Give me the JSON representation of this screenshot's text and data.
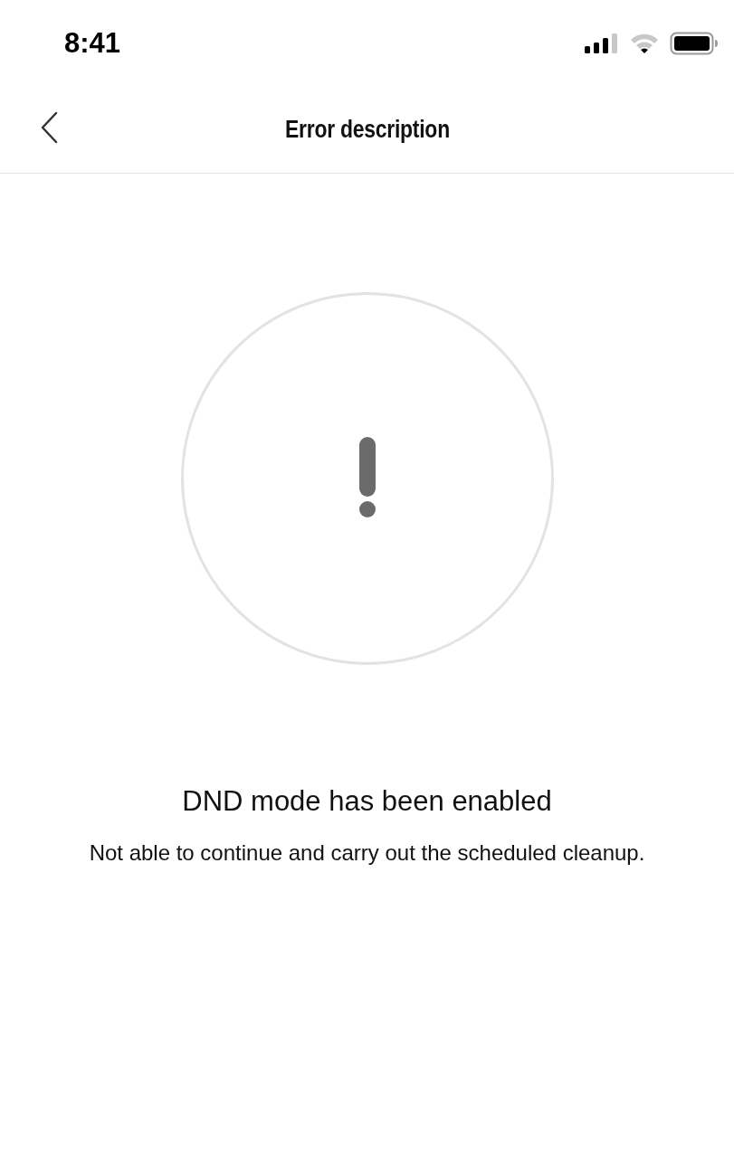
{
  "status_bar": {
    "time": "8:41"
  },
  "header": {
    "title": "Error description"
  },
  "error": {
    "title": "DND mode has been enabled",
    "description": "Not able to continue and carry out the scheduled cleanup."
  }
}
